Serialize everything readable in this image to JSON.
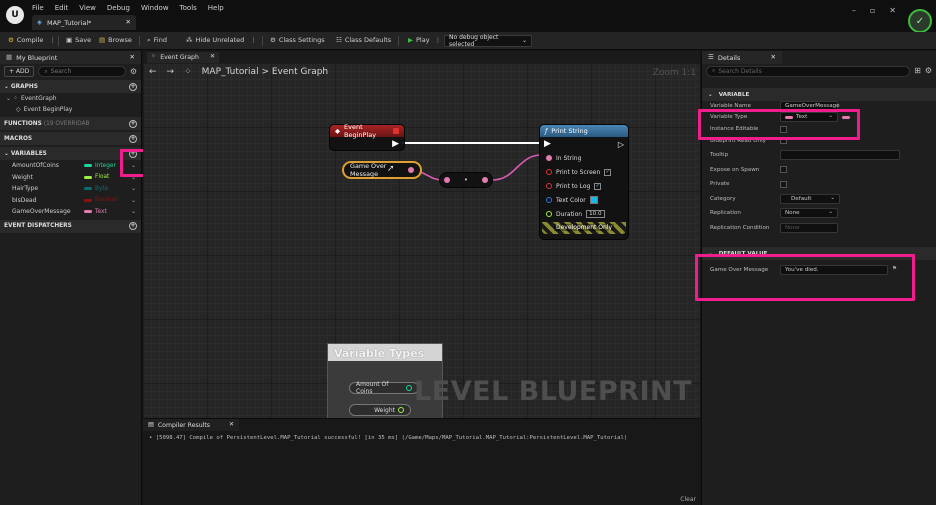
{
  "app": {
    "menu": [
      "File",
      "Edit",
      "View",
      "Debug",
      "Window",
      "Tools",
      "Help"
    ],
    "doc_tab": "MAP_Tutorial*"
  },
  "toolbar": {
    "compile": "Compile",
    "save": "Save",
    "browse": "Browse",
    "find": "Find",
    "hide_unrelated": "Hide Unrelated",
    "class_settings": "Class Settings",
    "class_defaults": "Class Defaults",
    "play": "Play",
    "debug_object": "No debug object selected"
  },
  "my_blueprint": {
    "tab": "My Blueprint",
    "add_label": "+ ADD",
    "search_placeholder": "Search",
    "graphs_header": "GRAPHS",
    "event_graph": "EventGraph",
    "event_begin_play": "Event BeginPlay",
    "functions_header": "FUNCTIONS",
    "functions_count": "(19 OVERRIDAB",
    "macros_header": "MACROS",
    "variables_header": "VARIABLES",
    "dispatchers_header": "EVENT DISPATCHERS",
    "variables": [
      {
        "name": "AmountOfCoins",
        "type": "Integer",
        "color": "#1fd6a0"
      },
      {
        "name": "Weight",
        "type": "Float",
        "color": "#9cf04a"
      },
      {
        "name": "HairType",
        "type": "Byte",
        "color": "#0a6e6e"
      },
      {
        "name": "bIsDead",
        "type": "Boolean",
        "color": "#8c1111"
      },
      {
        "name": "GameOverMessage",
        "type": "Text",
        "color": "#e27bb0"
      }
    ]
  },
  "graph": {
    "tab": "Event Graph",
    "breadcrumb_root": "MAP_Tutorial",
    "breadcrumb_sep": ">",
    "breadcrumb_leaf": "Event Graph",
    "zoom": "Zoom 1:1",
    "event_node": "Event BeginPlay",
    "var_node": "Game Over Message",
    "print_node": {
      "title": "Print String",
      "in_string": "In String",
      "print_to_screen": "Print to Screen",
      "print_to_log": "Print to Log",
      "text_color": "Text Color",
      "duration_label": "Duration",
      "duration_value": "10.0",
      "dev_only": "Development Only",
      "text_color_swatch": "#1ab6e8"
    },
    "var_types_panel": {
      "title": "Variable Types",
      "node1": "Amount Of Coins",
      "node2": "Weight"
    },
    "watermark": "LEVEL BLUEPRINT"
  },
  "compiler": {
    "tab": "Compiler Results",
    "message": "• [5098.47] Compile of PersistentLevel.MAP_Tutorial successful! [in 35 ms] (/Game/Maps/MAP_Tutorial.MAP_Tutorial:PersistentLevel.MAP_Tutorial)",
    "clear": "Clear"
  },
  "details": {
    "tab": "Details",
    "search_placeholder": "Search Details",
    "variable_header": "VARIABLE",
    "variable_name_label": "Variable Name",
    "variable_name_value": "GameOverMessage",
    "variable_type_label": "Variable Type",
    "variable_type_value": "Text",
    "instance_editable": "Instance Editable",
    "blueprint_read_only": "Blueprint Read Only",
    "tooltip": "Tooltip",
    "expose_on_spawn": "Expose on Spawn",
    "private": "Private",
    "category_label": "Category",
    "category_value": "Default",
    "replication_label": "Replication",
    "replication_value": "None",
    "replication_condition_label": "Replication Condition",
    "replication_condition_value": "None",
    "default_value_header": "DEFAULT VALUE",
    "default_label": "Game Over Message",
    "default_value": "You've died."
  },
  "colors": {
    "highlight": "#f01e8c",
    "text_pin": "#e27bb0",
    "exec_white": "#ffffff",
    "event_red": "#8f1c1c",
    "function_blue": "#356a92",
    "play_green": "#3dbb3d"
  }
}
